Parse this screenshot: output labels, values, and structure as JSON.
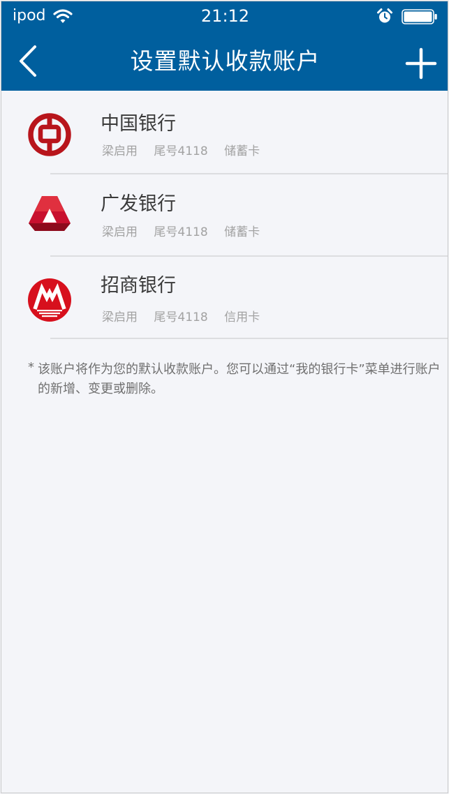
{
  "status_bar": {
    "carrier": "ipod",
    "time": "21:12"
  },
  "nav": {
    "title": "设置默认收款账户",
    "back_icon": "chevron-left-icon",
    "add_icon": "plus-icon"
  },
  "accounts": [
    {
      "bank_name": "中国银行",
      "holder": "梁启用",
      "tail": "尾号4118",
      "card_type": "储蓄卡",
      "logo": "boc-logo",
      "logo_color": "#b8151c"
    },
    {
      "bank_name": "广发银行",
      "holder": "梁启用",
      "tail": "尾号4118",
      "card_type": "储蓄卡",
      "logo": "cgb-logo",
      "logo_color": "#c8102e"
    },
    {
      "bank_name": "招商银行",
      "holder": "梁启用",
      "tail": "尾号4118",
      "card_type": "信用卡",
      "logo": "cmb-logo",
      "logo_color": "#d7101d"
    }
  ],
  "note": {
    "star": "*",
    "text": "该账户将作为您的默认收款账户。您可以通过“我的银行卡”菜单进行账户的新增、变更或删除。"
  },
  "colors": {
    "header": "#005f9e",
    "background": "#f4f5f9"
  }
}
